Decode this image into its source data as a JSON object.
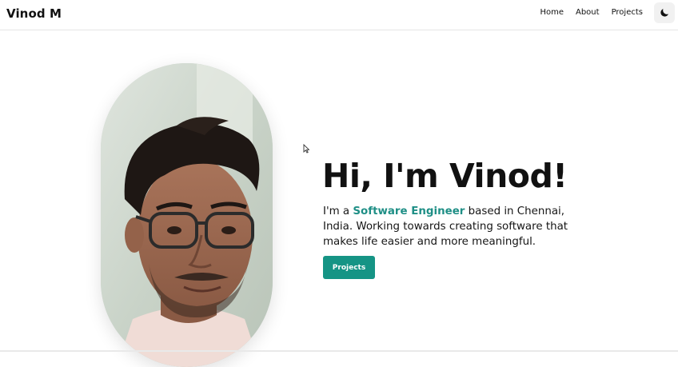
{
  "navbar": {
    "brand": "Vinod M",
    "links": [
      {
        "label": "Home"
      },
      {
        "label": "About"
      },
      {
        "label": "Projects"
      }
    ],
    "theme_toggle_icon": "moon-icon"
  },
  "hero": {
    "portrait_alt": "portrait-photo",
    "title": "Hi, I'm Vinod!",
    "intro_prefix": "I'm a ",
    "role": "Software Engineer",
    "intro_suffix": " based in Chennai, India. Working towards creating software that makes life easier and more meaningful.",
    "cta_label": "Projects"
  },
  "colors": {
    "accent": "#159485",
    "accent_text": "#1f8f86",
    "text": "#111111",
    "background": "#ffffff"
  }
}
